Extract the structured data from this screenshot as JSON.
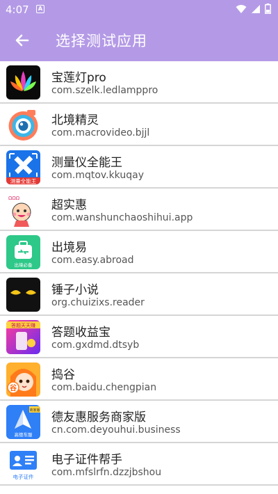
{
  "status": {
    "time": "4:07",
    "notif_letter": "A"
  },
  "header": {
    "title": "选择测试应用"
  },
  "apps": [
    {
      "name": "宝莲灯pro",
      "package": "com.szelk.ledlamppro",
      "icon": "lotus-icon"
    },
    {
      "name": "北境精灵",
      "package": "com.macrovideo.bjjl",
      "icon": "camera-eye-icon"
    },
    {
      "name": "测量仪全能王",
      "package": "com.mqtov.kkuqay",
      "icon": "ruler-pencil-icon",
      "icon_caption": "测量全能王"
    },
    {
      "name": "超实惠",
      "package": "com.wanshunchaoshihui.app",
      "icon": "cartoon-baby-icon"
    },
    {
      "name": "出境易",
      "package": "com.easy.abroad",
      "icon": "suitcase-icon",
      "icon_caption": "出境必备"
    },
    {
      "name": "锤子小说",
      "package": "org.chuizixs.reader",
      "icon": "eyes-icon"
    },
    {
      "name": "答题收益宝",
      "package": "com.gxdmd.dtsyb",
      "icon": "quiz-reward-icon",
      "icon_caption": "答题天天赚"
    },
    {
      "name": "捣谷",
      "package": "com.baidu.chengpian",
      "icon": "anime-girl-icon",
      "icon_caption": "谷"
    },
    {
      "name": "德友惠服务商家版",
      "package": "cn.com.deyouhui.business",
      "icon": "paper-plane-icon",
      "icon_caption": "高德车服",
      "icon_badge": "商家版"
    },
    {
      "name": "电子证件帮手",
      "package": "com.mfslrfn.dzzjbshou",
      "icon": "id-card-icon",
      "icon_caption": "电子证件"
    }
  ]
}
